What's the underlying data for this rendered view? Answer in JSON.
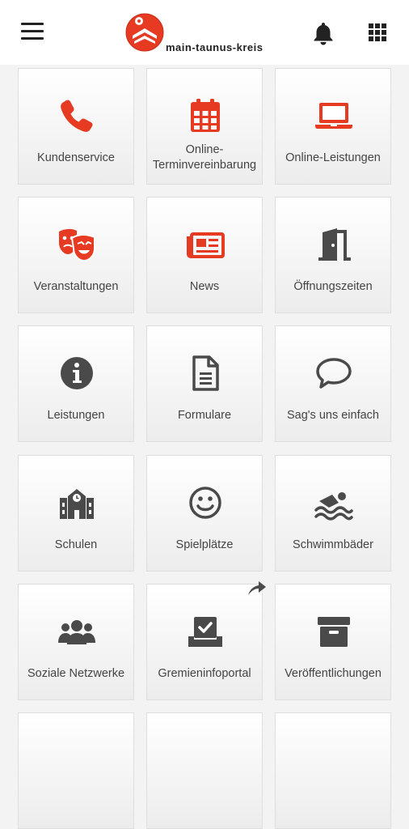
{
  "header": {
    "logo_text": "main-taunus-kreis",
    "icons": [
      "hamburger-menu-icon",
      "bell-icon",
      "apps-grid-icon"
    ]
  },
  "colors": {
    "accent": "#e63a22",
    "icon_gray": "#4a4a4a",
    "text": "#444444"
  },
  "tiles": [
    {
      "label": "Kundenservice",
      "icon": "phone-icon"
    },
    {
      "label": "Online-Terminvereinbarung",
      "icon": "calendar-icon"
    },
    {
      "label": "Online-Leistungen",
      "icon": "laptop-icon"
    },
    {
      "label": "Veranstaltungen",
      "icon": "theater-masks-icon"
    },
    {
      "label": "News",
      "icon": "newspaper-icon"
    },
    {
      "label": "Öffnungszeiten",
      "icon": "door-open-icon"
    },
    {
      "label": "Leistungen",
      "icon": "info-circle-icon"
    },
    {
      "label": "Formulare",
      "icon": "document-icon"
    },
    {
      "label": "Sag's uns einfach",
      "icon": "speech-bubble-icon"
    },
    {
      "label": "Schulen",
      "icon": "school-icon"
    },
    {
      "label": "Spielplätze",
      "icon": "smiley-icon"
    },
    {
      "label": "Schwimmbäder",
      "icon": "swimmer-icon"
    },
    {
      "label": "Soziale Netzwerke",
      "icon": "users-icon"
    },
    {
      "label": "Gremieninfoportal",
      "icon": "vote-box-icon"
    },
    {
      "label": "Veröffentlichungen",
      "icon": "archive-box-icon"
    }
  ]
}
